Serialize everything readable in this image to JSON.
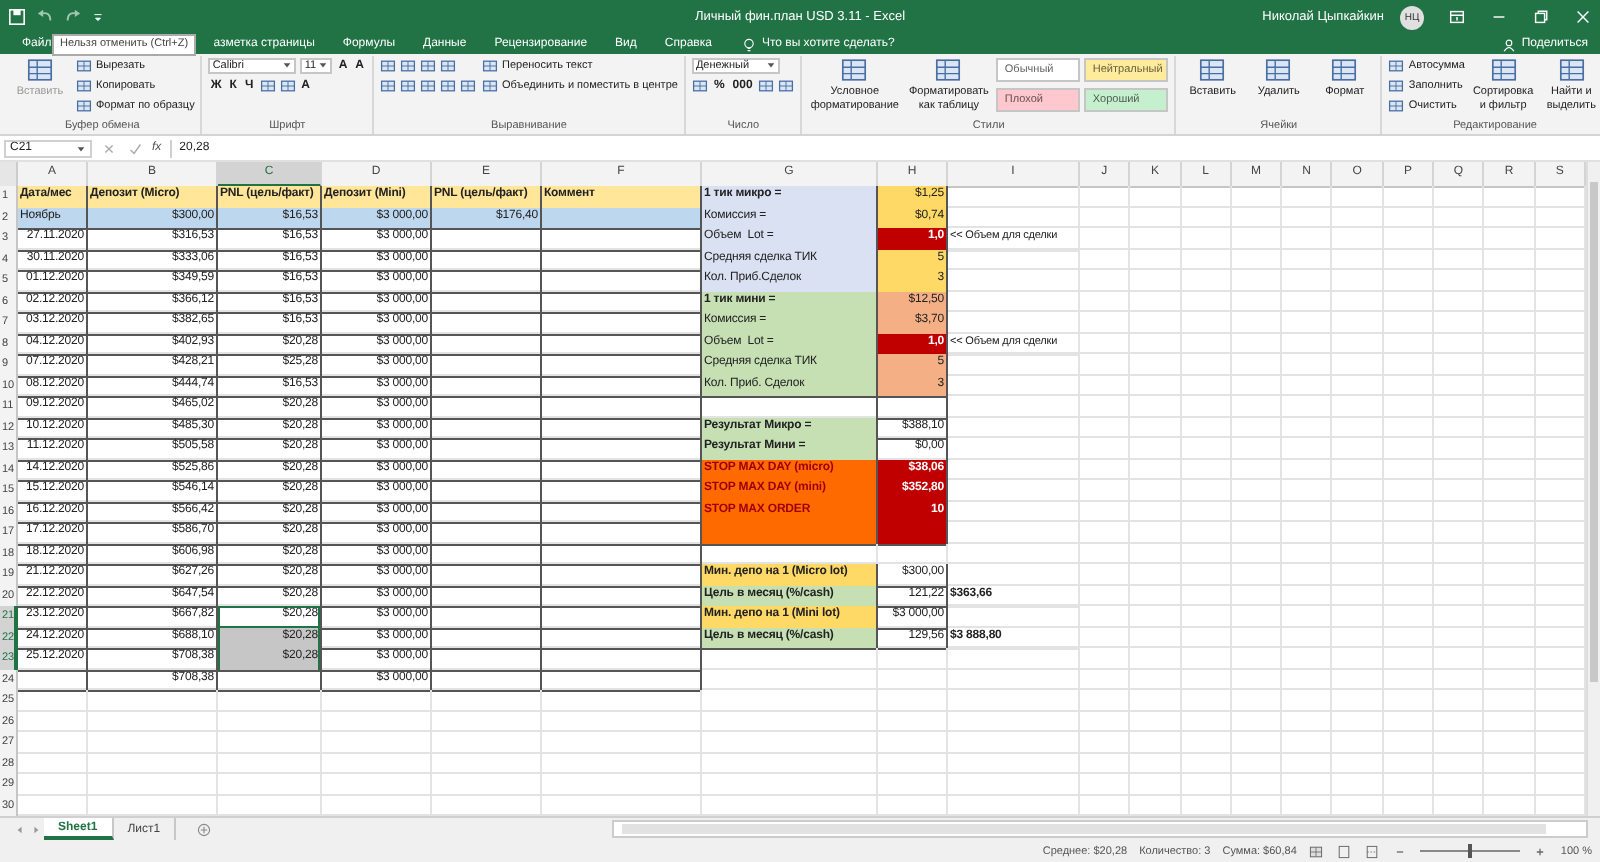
{
  "window": {
    "title": "Личный фин.план USD 3.11  -  Excel",
    "user": "Николай Цыпкайкин",
    "user_initials": "НЦ"
  },
  "tabs": [
    "Файл",
    "азметка страницы",
    "Формулы",
    "Данные",
    "Рецензирование",
    "Вид",
    "Справка"
  ],
  "tooltip": "Нельзя отменить (Ctrl+Z)",
  "tell_me": "Что вы хотите сделать?",
  "share": "Поделиться",
  "ribbon": [
    {
      "label": "Буфер обмена",
      "cols": [
        [
          [
            {
              "kind": "big",
              "label": "Вставить",
              "disabled": true
            }
          ]
        ],
        [
          [
            {
              "kind": "small",
              "label": "Вырезать",
              "disabled": false
            }
          ],
          [
            {
              "kind": "small",
              "label": "Копировать",
              "disabled": false
            }
          ],
          [
            {
              "kind": "small",
              "label": "Формат по образцу",
              "disabled": false
            }
          ]
        ]
      ]
    },
    {
      "label": "Шрифт",
      "cols": [
        [
          [
            {
              "kind": "field",
              "value": "Calibri"
            },
            {
              "kind": "field-narrow",
              "value": "11"
            },
            {
              "kind": "glyph",
              "label": "A"
            },
            {
              "kind": "glyph",
              "label": "A"
            }
          ],
          [
            {
              "kind": "glyph",
              "label": "Ж"
            },
            {
              "kind": "glyph",
              "label": "К"
            },
            {
              "kind": "glyph",
              "label": "Ч"
            },
            {
              "kind": "icon"
            },
            {
              "kind": "icon"
            },
            {
              "kind": "glyph",
              "label": "A"
            }
          ]
        ]
      ]
    },
    {
      "label": "Выравнивание",
      "cols": [
        [
          [
            {
              "kind": "icon"
            },
            {
              "kind": "icon"
            },
            {
              "kind": "icon"
            },
            {
              "kind": "icon"
            }
          ],
          [
            {
              "kind": "icon"
            },
            {
              "kind": "icon"
            },
            {
              "kind": "icon"
            },
            {
              "kind": "icon"
            },
            {
              "kind": "icon"
            }
          ]
        ],
        [
          [
            {
              "kind": "small",
              "label": "Переносить текст"
            }
          ],
          [
            {
              "kind": "small",
              "label": "Объединить и поместить в центре"
            }
          ]
        ]
      ]
    },
    {
      "label": "Число",
      "cols": [
        [
          [
            {
              "kind": "field",
              "value": "Денежный"
            }
          ],
          [
            {
              "kind": "icon"
            },
            {
              "kind": "glyph",
              "label": "%"
            },
            {
              "kind": "glyph",
              "label": "000"
            },
            {
              "kind": "icon"
            },
            {
              "kind": "icon"
            }
          ]
        ]
      ]
    },
    {
      "label": "Стили",
      "cols": [
        [
          [
            {
              "kind": "big",
              "label": "Условное форматирование"
            }
          ]
        ],
        [
          [
            {
              "kind": "big",
              "label": "Форматировать как таблицу"
            }
          ]
        ],
        [
          [
            {
              "kind": "swatch",
              "label": "Обычный",
              "color": "#ffffff"
            },
            {
              "kind": "swatch",
              "label": "Нейтральный",
              "color": "#ffeb9c"
            }
          ],
          [
            {
              "kind": "swatch",
              "label": "Плохой",
              "color": "#ffc7ce"
            },
            {
              "kind": "swatch",
              "label": "Хороший",
              "color": "#c6efce"
            }
          ]
        ]
      ]
    },
    {
      "label": "Ячейки",
      "cols": [
        [
          [
            {
              "kind": "big",
              "label": "Вставить"
            }
          ]
        ],
        [
          [
            {
              "kind": "big",
              "label": "Удалить"
            }
          ]
        ],
        [
          [
            {
              "kind": "big",
              "label": "Формат"
            }
          ]
        ]
      ]
    },
    {
      "label": "Редактирование",
      "cols": [
        [
          [
            {
              "kind": "small",
              "label": "Автосумма"
            }
          ],
          [
            {
              "kind": "small",
              "label": "Заполнить"
            }
          ],
          [
            {
              "kind": "small",
              "label": "Очистить"
            }
          ]
        ],
        [
          [
            {
              "kind": "big",
              "label": "Сортировка и фильтр"
            }
          ]
        ],
        [
          [
            {
              "kind": "big",
              "label": "Найти и выделить"
            }
          ]
        ]
      ]
    }
  ],
  "formula_bar": {
    "name_box": "C21",
    "fx": "fx",
    "value": "20,28"
  },
  "columns": [
    {
      "label": "A",
      "selected": false
    },
    {
      "label": "B",
      "selected": false
    },
    {
      "label": "C",
      "selected": true
    },
    {
      "label": "D",
      "selected": false
    },
    {
      "label": "E",
      "selected": false
    },
    {
      "label": "F",
      "selected": false
    },
    {
      "label": "G",
      "selected": false
    },
    {
      "label": "H",
      "selected": false
    },
    {
      "label": "I",
      "selected": false
    },
    {
      "label": "J",
      "selected": false
    },
    {
      "label": "K",
      "selected": false
    },
    {
      "label": "L",
      "selected": false
    },
    {
      "label": "M",
      "selected": false
    },
    {
      "label": "N",
      "selected": false
    },
    {
      "label": "O",
      "selected": false
    },
    {
      "label": "P",
      "selected": false
    },
    {
      "label": "Q",
      "selected": false
    },
    {
      "label": "R",
      "selected": false
    },
    {
      "label": "S",
      "selected": false
    }
  ],
  "rows": [
    {
      "n": "1",
      "selected": false,
      "cells": [
        {
          "kind": "header",
          "text": "Дата/мес"
        },
        {
          "kind": "header",
          "text": "Депозит (Micro)"
        },
        {
          "kind": "header",
          "text": "PNL (цель/факт)"
        },
        {
          "kind": "header",
          "text": "Депозит (Mini)"
        },
        {
          "kind": "header",
          "text": "PNL (цель/факт)"
        },
        {
          "kind": "header",
          "text": "Коммент"
        },
        {
          "kind": "g-blue-b",
          "text": "1 тик микро ="
        },
        {
          "kind": "v-yellow",
          "text": "$1,25"
        }
      ]
    },
    {
      "n": "2",
      "selected": false,
      "cells": [
        {
          "kind": "month",
          "text": "Ноябрь"
        },
        {
          "kind": "month-num",
          "text": "$300,00"
        },
        {
          "kind": "month-num",
          "text": "$16,53"
        },
        {
          "kind": "month-num",
          "text": "$3 000,00"
        },
        {
          "kind": "month-num",
          "text": "$176,40"
        },
        {
          "kind": "month"
        },
        {
          "kind": "g-blue",
          "text": "Комиссия ="
        },
        {
          "kind": "v-yellow",
          "text": "$0,74"
        }
      ]
    },
    {
      "n": "3",
      "selected": false,
      "cells": [
        {
          "kind": "num",
          "text": "27.11.2020"
        },
        {
          "kind": "num",
          "text": "$316,53"
        },
        {
          "kind": "num",
          "text": "$16,53"
        },
        {
          "kind": "num",
          "text": "$3 000,00"
        },
        {
          "kind": "plain"
        },
        {
          "kind": "plain"
        },
        {
          "kind": "g-blue",
          "text": "Объем  Lot ="
        },
        {
          "kind": "v-red",
          "text": "1,0"
        },
        {
          "kind": "note",
          "text": "<< Объем для сделки"
        }
      ]
    },
    {
      "n": "4",
      "selected": false,
      "cells": [
        {
          "kind": "num",
          "text": "30.11.2020"
        },
        {
          "kind": "num",
          "text": "$333,06"
        },
        {
          "kind": "num",
          "text": "$16,53"
        },
        {
          "kind": "num",
          "text": "$3 000,00"
        },
        {
          "kind": "plain"
        },
        {
          "kind": "plain"
        },
        {
          "kind": "g-blue",
          "text": "Средняя сделка ТИК"
        },
        {
          "kind": "v-yellow",
          "text": "5"
        }
      ]
    },
    {
      "n": "5",
      "selected": false,
      "cells": [
        {
          "kind": "num",
          "text": "01.12.2020"
        },
        {
          "kind": "num",
          "text": "$349,59"
        },
        {
          "kind": "num",
          "text": "$16,53"
        },
        {
          "kind": "num",
          "text": "$3 000,00"
        },
        {
          "kind": "plain"
        },
        {
          "kind": "plain"
        },
        {
          "kind": "g-blue",
          "text": "Кол. Приб.Сделок"
        },
        {
          "kind": "v-yellow",
          "text": "3"
        }
      ]
    },
    {
      "n": "6",
      "selected": false,
      "cells": [
        {
          "kind": "num",
          "text": "02.12.2020"
        },
        {
          "kind": "num",
          "text": "$366,12"
        },
        {
          "kind": "num",
          "text": "$16,53"
        },
        {
          "kind": "num",
          "text": "$3 000,00"
        },
        {
          "kind": "plain"
        },
        {
          "kind": "plain"
        },
        {
          "kind": "g-green-b",
          "text": "1 тик мини ="
        },
        {
          "kind": "v-salmon",
          "text": "$12,50"
        }
      ]
    },
    {
      "n": "7",
      "selected": false,
      "cells": [
        {
          "kind": "num",
          "text": "03.12.2020"
        },
        {
          "kind": "num",
          "text": "$382,65"
        },
        {
          "kind": "num",
          "text": "$16,53"
        },
        {
          "kind": "num",
          "text": "$3 000,00"
        },
        {
          "kind": "plain"
        },
        {
          "kind": "plain"
        },
        {
          "kind": "g-green",
          "text": "Комиссия ="
        },
        {
          "kind": "v-salmon",
          "text": "$3,70"
        }
      ]
    },
    {
      "n": "8",
      "selected": false,
      "cells": [
        {
          "kind": "num",
          "text": "04.12.2020"
        },
        {
          "kind": "num",
          "text": "$402,93"
        },
        {
          "kind": "num",
          "text": "$20,28"
        },
        {
          "kind": "num",
          "text": "$3 000,00"
        },
        {
          "kind": "plain"
        },
        {
          "kind": "plain"
        },
        {
          "kind": "g-green",
          "text": "Объем  Lot ="
        },
        {
          "kind": "v-red",
          "text": "1,0"
        },
        {
          "kind": "note",
          "text": "<< Объем для сделки"
        }
      ]
    },
    {
      "n": "9",
      "selected": false,
      "cells": [
        {
          "kind": "num",
          "text": "07.12.2020"
        },
        {
          "kind": "num",
          "text": "$428,21"
        },
        {
          "kind": "num",
          "text": "$25,28"
        },
        {
          "kind": "num",
          "text": "$3 000,00"
        },
        {
          "kind": "plain"
        },
        {
          "kind": "plain"
        },
        {
          "kind": "g-green",
          "text": "Средняя сделка ТИК"
        },
        {
          "kind": "v-salmon",
          "text": "5"
        }
      ]
    },
    {
      "n": "10",
      "selected": false,
      "cells": [
        {
          "kind": "num",
          "text": "08.12.2020"
        },
        {
          "kind": "num",
          "text": "$444,74"
        },
        {
          "kind": "num",
          "text": "$16,53"
        },
        {
          "kind": "num",
          "text": "$3 000,00"
        },
        {
          "kind": "plain"
        },
        {
          "kind": "plain"
        },
        {
          "kind": "g-green",
          "text": "Кол. Приб. Сделок"
        },
        {
          "kind": "v-salmon",
          "text": "3"
        }
      ]
    },
    {
      "n": "11",
      "selected": false,
      "cells": [
        {
          "kind": "num",
          "text": "09.12.2020"
        },
        {
          "kind": "num",
          "text": "$465,02"
        },
        {
          "kind": "num",
          "text": "$20,28"
        },
        {
          "kind": "num",
          "text": "$3 000,00"
        },
        {
          "kind": "plain"
        },
        {
          "kind": "plain"
        },
        {
          "kind": "plain"
        },
        {
          "kind": "plain"
        }
      ]
    },
    {
      "n": "12",
      "selected": false,
      "cells": [
        {
          "kind": "num",
          "text": "10.12.2020"
        },
        {
          "kind": "num",
          "text": "$485,30"
        },
        {
          "kind": "num",
          "text": "$20,28"
        },
        {
          "kind": "num",
          "text": "$3 000,00"
        },
        {
          "kind": "plain"
        },
        {
          "kind": "plain"
        },
        {
          "kind": "g-green-b",
          "text": "Результат Микро ="
        },
        {
          "kind": "v-white",
          "text": "$388,10"
        }
      ]
    },
    {
      "n": "13",
      "selected": false,
      "cells": [
        {
          "kind": "num",
          "text": "11.12.2020"
        },
        {
          "kind": "num",
          "text": "$505,58"
        },
        {
          "kind": "num",
          "text": "$20,28"
        },
        {
          "kind": "num",
          "text": "$3 000,00"
        },
        {
          "kind": "plain"
        },
        {
          "kind": "plain"
        },
        {
          "kind": "g-green-b",
          "text": "Результат Мини ="
        },
        {
          "kind": "v-white",
          "text": "$0,00"
        }
      ]
    },
    {
      "n": "14",
      "selected": false,
      "cells": [
        {
          "kind": "num",
          "text": "14.12.2020"
        },
        {
          "kind": "num",
          "text": "$525,86"
        },
        {
          "kind": "num",
          "text": "$20,28"
        },
        {
          "kind": "num",
          "text": "$3 000,00"
        },
        {
          "kind": "plain"
        },
        {
          "kind": "plain"
        },
        {
          "kind": "g-orange",
          "text": "STOP MAX DAY (micro)"
        },
        {
          "kind": "v-red",
          "text": "$38,06"
        }
      ]
    },
    {
      "n": "15",
      "selected": false,
      "cells": [
        {
          "kind": "num",
          "text": "15.12.2020"
        },
        {
          "kind": "num",
          "text": "$546,14"
        },
        {
          "kind": "num",
          "text": "$20,28"
        },
        {
          "kind": "num",
          "text": "$3 000,00"
        },
        {
          "kind": "plain"
        },
        {
          "kind": "plain"
        },
        {
          "kind": "g-orange",
          "text": "STOP MAX DAY (mini)"
        },
        {
          "kind": "v-red",
          "text": "$352,80"
        }
      ]
    },
    {
      "n": "16",
      "selected": false,
      "cells": [
        {
          "kind": "num",
          "text": "16.12.2020"
        },
        {
          "kind": "num",
          "text": "$566,42"
        },
        {
          "kind": "num",
          "text": "$20,28"
        },
        {
          "kind": "num",
          "text": "$3 000,00"
        },
        {
          "kind": "plain"
        },
        {
          "kind": "plain"
        },
        {
          "kind": "g-orange",
          "text": "STOP MAX ORDER"
        },
        {
          "kind": "v-red",
          "text": "10"
        }
      ]
    },
    {
      "n": "17",
      "selected": false,
      "cells": [
        {
          "kind": "num",
          "text": "17.12.2020"
        },
        {
          "kind": "num",
          "text": "$586,70"
        },
        {
          "kind": "num",
          "text": "$20,28"
        },
        {
          "kind": "num",
          "text": "$3 000,00"
        },
        {
          "kind": "plain"
        },
        {
          "kind": "plain"
        },
        {
          "kind": "g-orange"
        },
        {
          "kind": "v-red"
        }
      ]
    },
    {
      "n": "18",
      "selected": false,
      "cells": [
        {
          "kind": "num",
          "text": "18.12.2020"
        },
        {
          "kind": "num",
          "text": "$606,98"
        },
        {
          "kind": "num",
          "text": "$20,28"
        },
        {
          "kind": "num",
          "text": "$3 000,00"
        },
        {
          "kind": "plain"
        },
        {
          "kind": "plain"
        }
      ]
    },
    {
      "n": "19",
      "selected": false,
      "cells": [
        {
          "kind": "num",
          "text": "21.12.2020"
        },
        {
          "kind": "num",
          "text": "$627,26"
        },
        {
          "kind": "num",
          "text": "$20,28"
        },
        {
          "kind": "num",
          "text": "$3 000,00"
        },
        {
          "kind": "plain"
        },
        {
          "kind": "plain"
        },
        {
          "kind": "g-yellow-b",
          "text": "Мин. депо на 1 (Micro lot)"
        },
        {
          "kind": "v-white",
          "text": "$300,00"
        }
      ]
    },
    {
      "n": "20",
      "selected": false,
      "cells": [
        {
          "kind": "num",
          "text": "22.12.2020"
        },
        {
          "kind": "num",
          "text": "$647,54"
        },
        {
          "kind": "num",
          "text": "$20,28"
        },
        {
          "kind": "num",
          "text": "$3 000,00"
        },
        {
          "kind": "plain"
        },
        {
          "kind": "plain"
        },
        {
          "kind": "g-green-b",
          "text": "Цель в месяц (%/cash)"
        },
        {
          "kind": "v-white",
          "text": "121,22"
        },
        {
          "kind": "note-b",
          "text": "$363,66"
        }
      ]
    },
    {
      "n": "21",
      "selected": true,
      "cells": [
        {
          "kind": "num",
          "text": "23.12.2020"
        },
        {
          "kind": "num",
          "text": "$667,82"
        },
        {
          "kind": "active",
          "text": "$20,28"
        },
        {
          "kind": "num",
          "text": "$3 000,00"
        },
        {
          "kind": "plain"
        },
        {
          "kind": "plain"
        },
        {
          "kind": "g-yellow-b",
          "text": "Мин. депо на 1 (Mini lot)"
        },
        {
          "kind": "v-white",
          "text": "$3 000,00"
        }
      ]
    },
    {
      "n": "22",
      "selected": true,
      "cells": [
        {
          "kind": "num",
          "text": "24.12.2020"
        },
        {
          "kind": "num",
          "text": "$688,10"
        },
        {
          "kind": "sel",
          "text": "$20,28"
        },
        {
          "kind": "num",
          "text": "$3 000,00"
        },
        {
          "kind": "plain"
        },
        {
          "kind": "plain"
        },
        {
          "kind": "g-green-b",
          "text": "Цель в месяц (%/cash)"
        },
        {
          "kind": "v-white",
          "text": "129,56"
        },
        {
          "kind": "note-b",
          "text": "$3 888,80"
        }
      ]
    },
    {
      "n": "23",
      "selected": true,
      "cells": [
        {
          "kind": "num",
          "text": "25.12.2020"
        },
        {
          "kind": "num",
          "text": "$708,38"
        },
        {
          "kind": "sel",
          "text": "$20,28"
        },
        {
          "kind": "num",
          "text": "$3 000,00"
        },
        {
          "kind": "plain"
        },
        {
          "kind": "plain"
        }
      ]
    },
    {
      "n": "24",
      "selected": false,
      "cells": [
        {
          "kind": "plain"
        },
        {
          "kind": "num",
          "text": "$708,38"
        },
        {
          "kind": "plain"
        },
        {
          "kind": "num",
          "text": "$3 000,00"
        },
        {
          "kind": "plain"
        },
        {
          "kind": "plain"
        }
      ]
    },
    {
      "n": "25",
      "selected": false
    },
    {
      "n": "26",
      "selected": false
    },
    {
      "n": "27",
      "selected": false
    },
    {
      "n": "28",
      "selected": false
    },
    {
      "n": "29",
      "selected": false
    },
    {
      "n": "30",
      "selected": false
    }
  ],
  "sheets": [
    {
      "label": "Sheet1",
      "selected": true
    },
    {
      "label": "Лист1",
      "selected": false
    }
  ],
  "status": {
    "stats": [
      "Среднее: $20,28",
      "Количество: 3",
      "Сумма: $60,84"
    ],
    "zoom": {
      "level": 0.5,
      "label": "100 %"
    }
  }
}
